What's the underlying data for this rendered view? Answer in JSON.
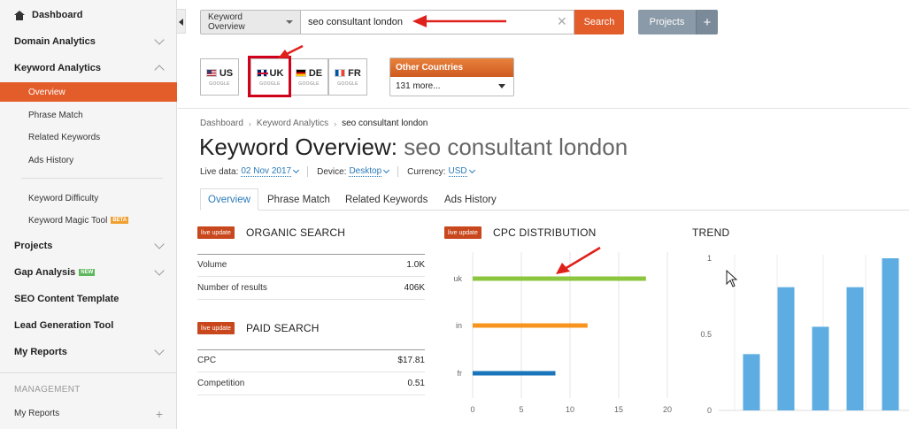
{
  "sidebar": {
    "dashboard": "Dashboard",
    "domain_analytics": "Domain Analytics",
    "keyword_analytics": "Keyword Analytics",
    "ka_items": [
      "Overview",
      "Phrase Match",
      "Related Keywords",
      "Ads History"
    ],
    "ka_tools": [
      "Keyword Difficulty",
      "Keyword Magic Tool"
    ],
    "beta_badge": "BETA",
    "projects": "Projects",
    "gap_analysis": "Gap Analysis",
    "new_badge": "NEW",
    "seo_content_template": "SEO Content Template",
    "lead_generation_tool": "Lead Generation Tool",
    "my_reports": "My Reports",
    "management_heading": "MANAGEMENT",
    "management_my_reports": "My Reports"
  },
  "search": {
    "type_label": "Keyword Overview",
    "query": "seo consultant london",
    "button": "Search",
    "projects_button": "Projects",
    "projects_plus": "+"
  },
  "databases": [
    {
      "code": "US",
      "engine": "GOOGLE",
      "flag": "us-flag-icon"
    },
    {
      "code": "UK",
      "engine": "GOOGLE",
      "flag": "uk-flag-icon",
      "selected": true
    },
    {
      "code": "DE",
      "engine": "GOOGLE",
      "flag": "de-flag-icon"
    },
    {
      "code": "FR",
      "engine": "GOOGLE",
      "flag": "fr-flag-icon"
    }
  ],
  "other_countries": {
    "label": "Other Countries",
    "selected": "131 more..."
  },
  "breadcrumb": [
    "Dashboard",
    "Keyword Analytics",
    "seo consultant london"
  ],
  "title": {
    "prefix": "Keyword Overview: ",
    "query": "seo consultant london"
  },
  "meta": {
    "live_label": "Live data:",
    "live_value": "02 Nov 2017",
    "device_label": "Device:",
    "device_value": "Desktop",
    "currency_label": "Currency:",
    "currency_value": "USD"
  },
  "tabs": [
    "Overview",
    "Phrase Match",
    "Related Keywords",
    "Ads History"
  ],
  "organic": {
    "badge": "live update",
    "title": "ORGANIC SEARCH",
    "rows": [
      {
        "label": "Volume",
        "value": "1.0K"
      },
      {
        "label": "Number of results",
        "value": "406K"
      }
    ]
  },
  "paid": {
    "badge": "live update",
    "title": "PAID SEARCH",
    "rows": [
      {
        "label": "CPC",
        "value": "$17.81"
      },
      {
        "label": "Competition",
        "value": "0.51"
      }
    ]
  },
  "cpc": {
    "badge": "live update",
    "title": "CPC DISTRIBUTION"
  },
  "trend": {
    "title": "TREND"
  },
  "colors": {
    "accent": "#e35d2b",
    "link": "#2a7ab9",
    "bar_uk": "#8cc63f",
    "bar_in": "#f7941d",
    "bar_fr": "#1a75bb",
    "trend_bar": "#5dade2"
  },
  "chart_data": [
    {
      "type": "bar",
      "orientation": "horizontal",
      "title": "CPC DISTRIBUTION",
      "categories": [
        "uk",
        "in",
        "fr"
      ],
      "values": [
        17.8,
        11.8,
        8.5
      ],
      "xlim": [
        0,
        20
      ],
      "xticks": [
        "0",
        "5",
        "10",
        "15",
        "20"
      ],
      "grid": true
    },
    {
      "type": "bar",
      "title": "TREND",
      "values": [
        0.37,
        0.81,
        0.55,
        0.81,
        1.0
      ],
      "ylim": [
        0,
        1
      ],
      "yticks": [
        "0",
        "0.5",
        "1"
      ],
      "grid": true
    }
  ]
}
